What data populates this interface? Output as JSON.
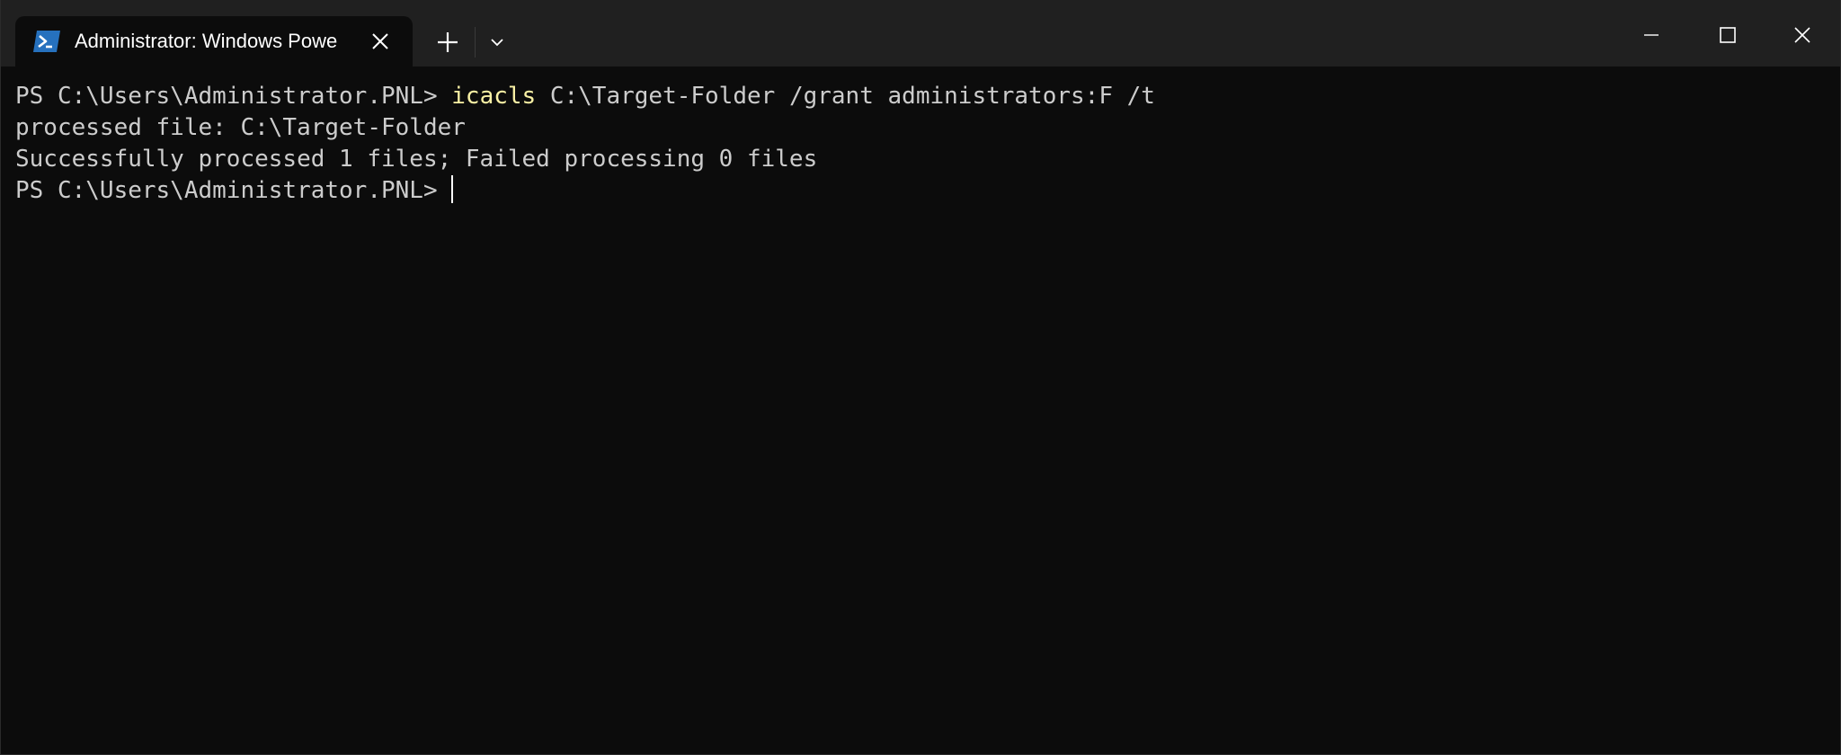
{
  "window": {
    "tab_title": "Administrator: Windows Powe",
    "icon": "powershell-icon",
    "accent_color": "#2671be"
  },
  "terminal": {
    "prompt": "PS C:\\Users\\Administrator.PNL> ",
    "command_name": "icacls",
    "command_args": " C:\\Target-Folder /grant administrators:F /t",
    "output": [
      "processed file: C:\\Target-Folder",
      "Successfully processed 1 files; Failed processing 0 files"
    ],
    "prompt2": "PS C:\\Users\\Administrator.PNL> "
  },
  "icons": {
    "tab_close": "close-icon",
    "new_tab": "plus-icon",
    "dropdown": "chevron-down-icon",
    "minimize": "minimize-icon",
    "maximize": "maximize-icon",
    "close_window": "close-icon"
  }
}
